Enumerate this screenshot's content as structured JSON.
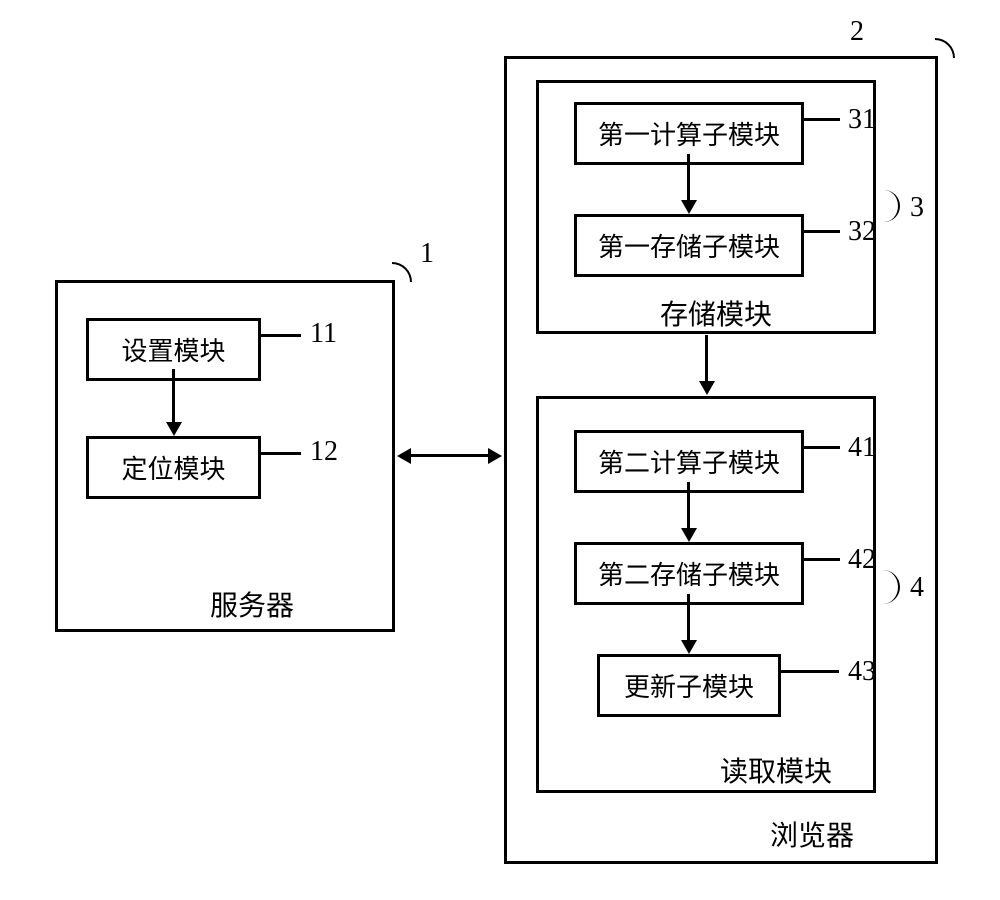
{
  "server": {
    "title": "服务器",
    "modules": {
      "settings": {
        "label": "设置模块",
        "num": "11"
      },
      "locate": {
        "label": "定位模块",
        "num": "12"
      }
    },
    "num": "1"
  },
  "browser": {
    "title": "浏览器",
    "num": "2",
    "storage": {
      "title": "存储模块",
      "num": "3",
      "sub1": {
        "label": "第一计算子模块",
        "num": "31"
      },
      "sub2": {
        "label": "第一存储子模块",
        "num": "32"
      }
    },
    "read": {
      "title": "读取模块",
      "num": "4",
      "sub1": {
        "label": "第二计算子模块",
        "num": "41"
      },
      "sub2": {
        "label": "第二存储子模块",
        "num": "42"
      },
      "sub3": {
        "label": "更新子模块",
        "num": "43"
      }
    }
  }
}
